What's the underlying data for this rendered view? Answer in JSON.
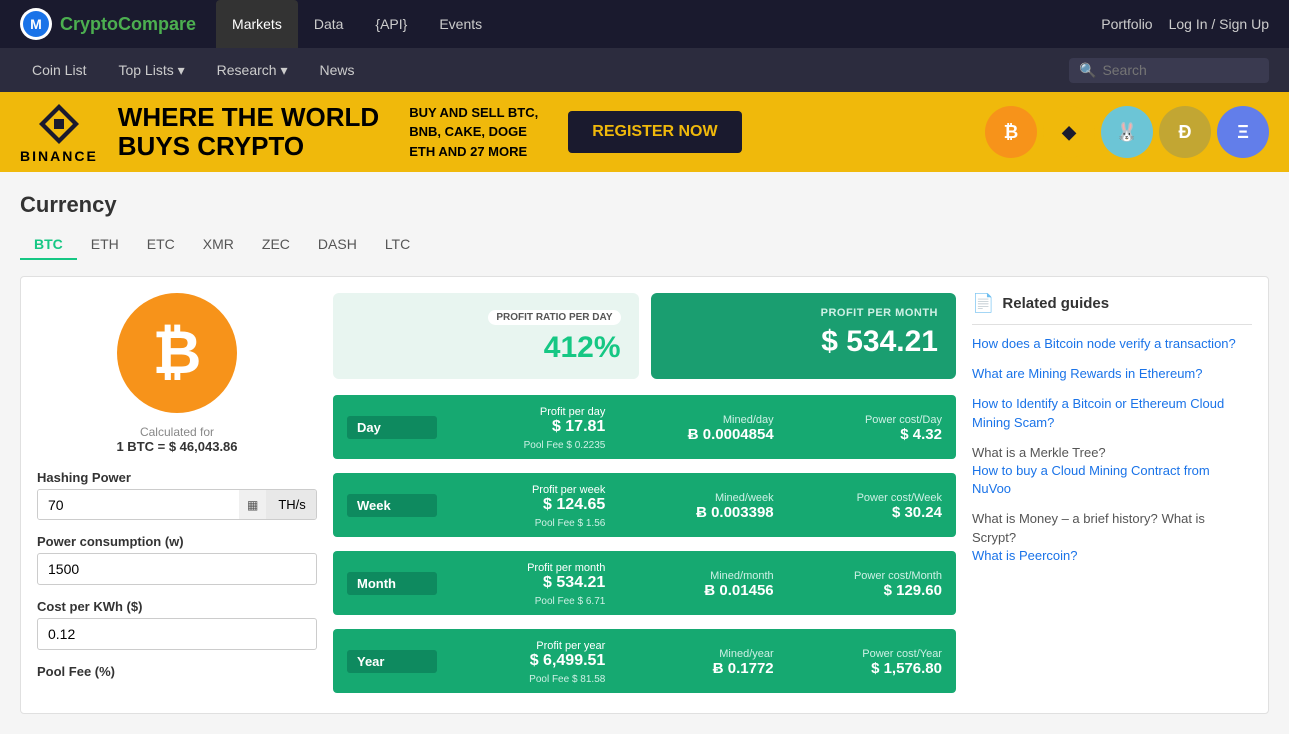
{
  "logo": {
    "icon_text": "M",
    "name": "CryptoCompare",
    "name_part1": "Crypto",
    "name_part2": "Compare"
  },
  "top_nav": {
    "items": [
      {
        "label": "Markets",
        "active": true
      },
      {
        "label": "Data",
        "active": false
      },
      {
        "label": "{API}",
        "active": false
      },
      {
        "label": "Events",
        "active": false
      }
    ],
    "right": [
      {
        "label": "Portfolio"
      },
      {
        "label": "Log In / Sign Up"
      }
    ]
  },
  "sub_nav": {
    "items": [
      {
        "label": "Coin List"
      },
      {
        "label": "Top Lists ▾"
      },
      {
        "label": "Research ▾"
      },
      {
        "label": "News"
      }
    ],
    "search_placeholder": "Search"
  },
  "banner": {
    "brand": "BINANCE",
    "headline_line1": "WHERE THE WORLD",
    "headline_line2": "BUYS CRYPTO",
    "subtext_line1": "BUY AND SELL BTC,",
    "subtext_line2": "BNB, CAKE, DOGE",
    "subtext_line3": "ETH AND 27 MORE",
    "cta": "REGISTER NOW",
    "coins": [
      {
        "symbol": "₿",
        "bg": "#f7931a",
        "color": "#fff"
      },
      {
        "symbol": "◆",
        "bg": "#f0b90b",
        "color": "#fff"
      },
      {
        "symbol": "🐰",
        "bg": "#6cc5d6",
        "color": "#fff"
      },
      {
        "symbol": "Ð",
        "bg": "#c2a633",
        "color": "#fff"
      },
      {
        "symbol": "Ξ",
        "bg": "#627eea",
        "color": "#fff"
      }
    ]
  },
  "page": {
    "title": "Currency",
    "tabs": [
      {
        "label": "BTC",
        "active": true
      },
      {
        "label": "ETH",
        "active": false
      },
      {
        "label": "ETC",
        "active": false
      },
      {
        "label": "XMR",
        "active": false
      },
      {
        "label": "ZEC",
        "active": false
      },
      {
        "label": "DASH",
        "active": false
      },
      {
        "label": "LTC",
        "active": false
      }
    ]
  },
  "left_panel": {
    "calculated_label": "Calculated for",
    "calculated_value": "1 BTC = $ 46,043.86",
    "hashing_power_label": "Hashing Power",
    "hashing_power_value": "70",
    "hashing_power_unit": "TH/s",
    "power_consumption_label": "Power consumption (w)",
    "power_consumption_value": "1500",
    "cost_per_kwh_label": "Cost per KWh ($)",
    "cost_per_kwh_value": "0.12",
    "pool_fee_label": "Pool Fee (%)"
  },
  "profit_summary": {
    "day": {
      "label": "PROFIT RATIO PER DAY",
      "value": "412%"
    },
    "month": {
      "label": "PROFIT PER MONTH",
      "value": "$ 534.21"
    }
  },
  "data_rows": [
    {
      "period": "Day",
      "profit_label": "Profit per day",
      "profit_value": "$ 17.81",
      "pool_fee": "Pool Fee $ 0.2235",
      "mined_label": "Mined/day",
      "mined_value": "Ƀ 0.0004854",
      "power_label": "Power cost/Day",
      "power_value": "$ 4.32"
    },
    {
      "period": "Week",
      "profit_label": "Profit per week",
      "profit_value": "$ 124.65",
      "pool_fee": "Pool Fee $ 1.56",
      "mined_label": "Mined/week",
      "mined_value": "Ƀ 0.003398",
      "power_label": "Power cost/Week",
      "power_value": "$ 30.24"
    },
    {
      "period": "Month",
      "profit_label": "Profit per month",
      "profit_value": "$ 534.21",
      "pool_fee": "Pool Fee $ 6.71",
      "mined_label": "Mined/month",
      "mined_value": "Ƀ 0.01456",
      "power_label": "Power cost/Month",
      "power_value": "$ 129.60"
    },
    {
      "period": "Year",
      "profit_label": "Profit per year",
      "profit_value": "$ 6,499.51",
      "pool_fee": "Pool Fee $ 81.58",
      "mined_label": "Mined/year",
      "mined_value": "Ƀ 0.1772",
      "power_label": "Power cost/Year",
      "power_value": "$ 1,576.80"
    }
  ],
  "related_guides": {
    "title": "Related guides",
    "links": [
      {
        "text": "How does a Bitcoin node verify a transaction?"
      },
      {
        "text": "What are Mining Rewards in Ethereum?"
      },
      {
        "text": "How to Identify a Bitcoin or Ethereum Cloud Mining Scam?"
      },
      {
        "text": "What is a Merkle Tree?"
      },
      {
        "text": "How to buy a Cloud Mining Contract from NuVoo"
      },
      {
        "text": "What is Money – a brief history?"
      },
      {
        "text": "What is Scrypt?"
      },
      {
        "text": "What is Peercoin?"
      }
    ]
  }
}
